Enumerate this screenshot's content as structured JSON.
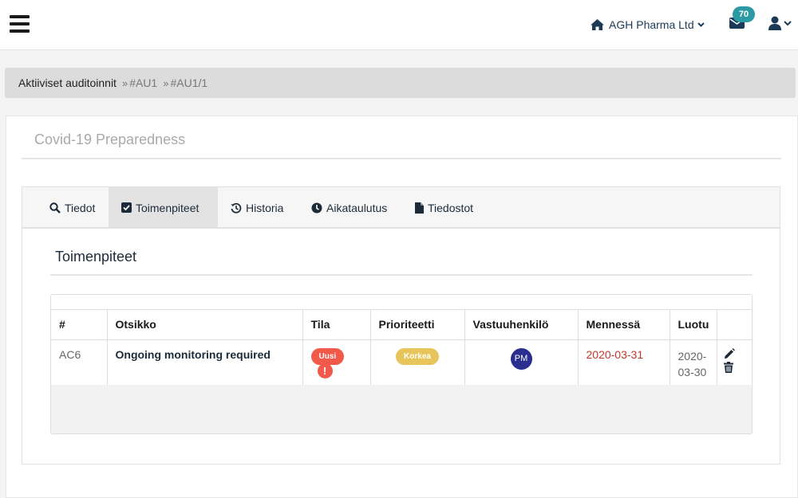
{
  "header": {
    "company_name": "AGH Pharma Ltd",
    "mail_count": "70"
  },
  "breadcrumb": {
    "main": "Aktiiviset auditoinnit",
    "sep": "»",
    "items": [
      "#AU1",
      "#AU1/1"
    ]
  },
  "page": {
    "title": "Covid-19 Preparedness"
  },
  "tabs": [
    {
      "label": "Tiedot",
      "icon": "search-icon"
    },
    {
      "label": "Toimenpiteet",
      "icon": "checkbox-icon",
      "active": true
    },
    {
      "label": "Historia",
      "icon": "history-icon"
    },
    {
      "label": "Aikataulutus",
      "icon": "clock-icon"
    },
    {
      "label": "Tiedostot",
      "icon": "file-icon"
    }
  ],
  "section": {
    "title": "Toimenpiteet"
  },
  "table": {
    "columns": [
      "#",
      "Otsikko",
      "Tila",
      "Prioriteetti",
      "Vastuuhenkilö",
      "Mennessä",
      "Luotu",
      ""
    ],
    "rows": [
      {
        "id": "AC6",
        "title": "Ongoing monitoring required",
        "status": "Uusi",
        "alert": "!",
        "priority": "Korkea",
        "assignee": "PM",
        "due": "2020-03-31",
        "created_line1": "2020-",
        "created_line2": "03-30"
      }
    ]
  },
  "colors": {
    "accent": "#2b9aa4",
    "status_new": "#f15a4a",
    "priority_high": "#e8c55a",
    "avatar": "#2a2f8f",
    "overdue": "#c0392b"
  }
}
